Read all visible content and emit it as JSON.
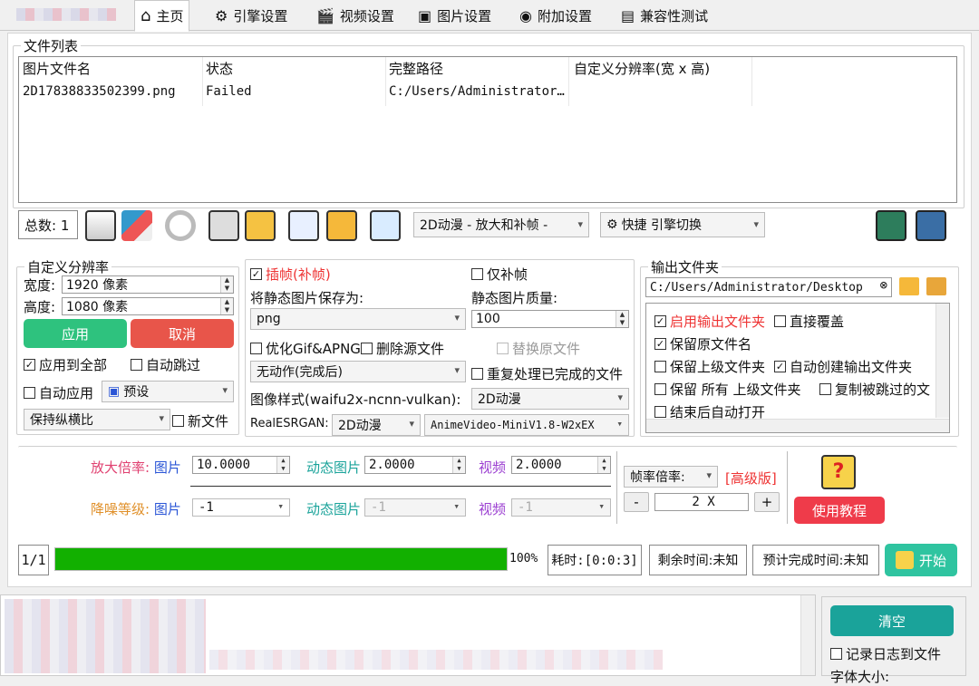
{
  "tabs": [
    {
      "label": "主页",
      "icon": "home-icon"
    },
    {
      "label": "引擎设置",
      "icon": "engine-icon"
    },
    {
      "label": "视频设置",
      "icon": "video-icon"
    },
    {
      "label": "图片设置",
      "icon": "image-icon"
    },
    {
      "label": "附加设置",
      "icon": "addon-icon"
    },
    {
      "label": "兼容性测试",
      "icon": "test-icon"
    }
  ],
  "file_list": {
    "legend": "文件列表",
    "columns": [
      "图片文件名",
      "状态",
      "完整路径",
      "自定义分辨率(宽 x 高)"
    ],
    "rows": [
      [
        "2D17838833502399.png",
        "Failed",
        "C:/Users/Administrator…",
        ""
      ]
    ]
  },
  "toolbar": {
    "count_label": "总数: 1",
    "mode_combo": "2D动漫 - 放大和补帧 -",
    "engine_combo": "快捷 引擎切换"
  },
  "custom_res": {
    "legend": "自定义分辨率",
    "width_label": "宽度:",
    "width_value": "1920 像素",
    "height_label": "高度:",
    "height_value": "1080 像素",
    "apply": "应用",
    "cancel": "取消",
    "apply_all": "应用到全部",
    "auto_skip": "自动跳过",
    "auto_apply": "自动应用",
    "preset": "预设",
    "keep_ratio": "保持纵横比",
    "new_file": "新文件"
  },
  "middle": {
    "interp": "插帧(补帧)",
    "interp_only": "仅补帧",
    "save_as_label": "将静态图片保存为:",
    "save_as_value": "png",
    "quality_label": "静态图片质量:",
    "quality_value": "100",
    "optimize_gif": "优化Gif&APNG",
    "delete_src": "删除源文件",
    "replace_orig": "替换原文件",
    "post_action": "无动作(完成后)",
    "reprocess": "重复处理已完成的文件",
    "style_label": "图像样式(waifu2x-ncnn-vulkan):",
    "style_value": "2D动漫",
    "esrgan_label": "RealESRGAN:",
    "esrgan_value": "2D动漫",
    "model_value": "AnimeVideo-MiniV1.8-W2xEX"
  },
  "output": {
    "legend": "输出文件夹",
    "path": "C:/Users/Administrator/Desktop",
    "options": [
      {
        "label": "启用输出文件夹",
        "checked": true,
        "red": true
      },
      {
        "label": "直接覆盖",
        "checked": false
      },
      {
        "label": "保留原文件名",
        "checked": true
      },
      {
        "label": "保留上级文件夹",
        "checked": false
      },
      {
        "label": "自动创建输出文件夹",
        "checked": true
      },
      {
        "label": "保留 所有 上级文件夹",
        "checked": false
      },
      {
        "label": "复制被跳过的文",
        "checked": false
      },
      {
        "label": "结束后自动打开",
        "checked": false
      }
    ]
  },
  "scale": {
    "scale_label": "放大倍率:",
    "denoise_label": "降噪等级:",
    "image": "图片",
    "gif": "动态图片",
    "video": "视频",
    "scale_image": "10.0000",
    "scale_gif": "2.0000",
    "scale_video": "2.0000",
    "denoise_image": "-1",
    "denoise_gif": "-1",
    "denoise_video": "-1",
    "fps_label": "帧率倍率:",
    "advanced": "[高级版]",
    "fps_value": "2 X",
    "minus": "-",
    "plus": "+",
    "tutorial": "使用教程"
  },
  "progress": {
    "page": "1/1",
    "percent_value": 100,
    "percent_text": "100%",
    "elapsed": "耗时:[0:0:3]",
    "remaining": "剩余时间:未知",
    "eta": "预计完成时间:未知",
    "start": "开始"
  },
  "log_panel": {
    "clear": "清空",
    "save_log": "记录日志到文件",
    "font_size": "字体大小:"
  },
  "colors": {
    "green": "#2ec27e",
    "red": "#e8554a",
    "teal": "#1aa39a",
    "progress": "#12b000",
    "accent_red": "#e33",
    "blue_text": "#2a55d6",
    "purple_text": "#9b3fd1",
    "pink_text": "#e04070"
  }
}
